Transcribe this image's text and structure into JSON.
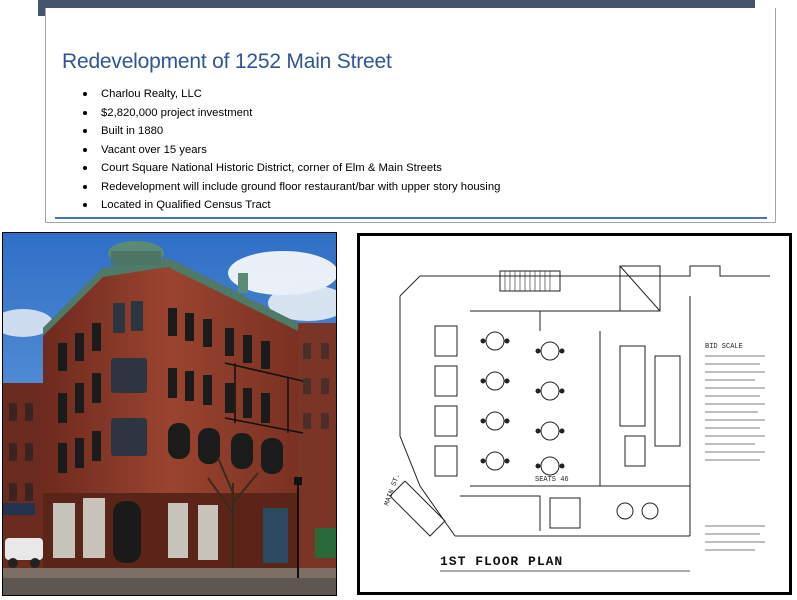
{
  "header": {
    "title": "Redevelopment of 1252 Main Street"
  },
  "bullets": [
    "Charlou Realty, LLC",
    "$2,820,000 project investment",
    "Built in 1880",
    "Vacant over 15 years",
    "Court Square National Historic District, corner of Elm & Main Streets",
    "Redevelopment will include ground floor restaurant/bar with upper story housing",
    "Located in Qualified Census Tract"
  ],
  "photo": {
    "subject": "building-photo"
  },
  "floor_plan": {
    "label": "1ST FLOOR PLAN",
    "street_label": "MAIN ST.",
    "seats_label": "SEATS 46",
    "legend_title": "BID SCALE"
  },
  "colors": {
    "title": "#2f5597",
    "topbar": "#44546a",
    "rule": "#4472c4",
    "brick": "#8b3a2a"
  }
}
